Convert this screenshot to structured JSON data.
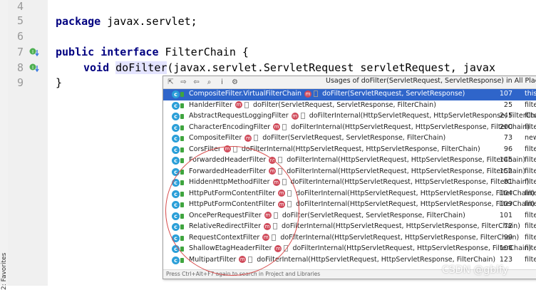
{
  "favorites_label": "2: Favorites",
  "gutter": {
    "lines": [
      "4",
      "5",
      "6",
      "7",
      "8",
      "9"
    ]
  },
  "code": {
    "line5_kw": "package",
    "line5_rest": " javax.servlet;",
    "line7_kw1": "public",
    "line7_kw2": "interface",
    "line7_rest": " FilterChain {",
    "line8_kw": "void",
    "line8_method": "doFilter",
    "line8_rest": "(javax.servlet.ServletRequest servletRequest, javax",
    "line9": "}"
  },
  "popup": {
    "title": "Usages of doFilter(ServletRequest, ServletResponse) in All Places",
    "toolbar": [
      "pin-icon",
      "forward-icon",
      "back-icon",
      "find-icon",
      "info-icon",
      "settings-icon"
    ],
    "rows": [
      {
        "cls": "CompositeFilter.VirtualFilterChain",
        "method": "doFilter(ServletRequest, ServletResponse)",
        "line": "107",
        "ctx": "this.",
        "selected": true
      },
      {
        "cls": "HanlderFilter",
        "method": "doFilter(ServletRequest, ServletResponse, FilterChain)",
        "line": "25",
        "ctx": "filte"
      },
      {
        "cls": "AbstractRequestLoggingFilter",
        "method": "doFilterInternal(HttpServletRequest, HttpServletResponse, FilterChain)",
        "line": "245",
        "ctx": "filte"
      },
      {
        "cls": "CharacterEncodingFilter",
        "method": "doFilterInternal(HttpServletRequest, HttpServletResponse, FilterChain)",
        "line": "200",
        "ctx": "filte"
      },
      {
        "cls": "CompositeFilter",
        "method": "doFilter(ServletRequest, ServletResponse, FilterChain)",
        "line": "73",
        "ctx": "new"
      },
      {
        "cls": "CorsFilter",
        "method": "doFilterInternal(HttpServletRequest, HttpServletResponse, FilterChain)",
        "line": "96",
        "ctx": "filte"
      },
      {
        "cls": "ForwardedHeaderFilter",
        "method": "doFilterInternal(HttpServletRequest, HttpServletResponse, FilterChain)",
        "line": "145",
        "ctx": "filte"
      },
      {
        "cls": "ForwardedHeaderFilter",
        "method": "doFilterInternal(HttpServletRequest, HttpServletResponse, FilterChain)",
        "line": "152",
        "ctx": "filte"
      },
      {
        "cls": "HiddenHttpMethodFilter",
        "method": "doFilterInternal(HttpServletRequest, HttpServletResponse, FilterChain)",
        "line": "81",
        "ctx": "filte"
      },
      {
        "cls": "HttpPutFormContentFilter",
        "method": "doFilterInternal(HttpServletRequest, HttpServletResponse, FilterChain)",
        "line": "104",
        "ctx": "filte"
      },
      {
        "cls": "HttpPutFormContentFilter",
        "method": "doFilterInternal(HttpServletRequest, HttpServletResponse, FilterChain)",
        "line": "109",
        "ctx": "filte"
      },
      {
        "cls": "OncePerRequestFilter",
        "method": "doFilter(ServletRequest, ServletResponse, FilterChain)",
        "line": "101",
        "ctx": "filte"
      },
      {
        "cls": "RelativeRedirectFilter",
        "method": "doFilterInternal(HttpServletRequest, HttpServletResponse, FilterChain)",
        "line": "72",
        "ctx": "filte"
      },
      {
        "cls": "RequestContextFilter",
        "method": "doFilterInternal(HttpServletRequest, HttpServletResponse, FilterChain)",
        "line": "99",
        "ctx": "filte"
      },
      {
        "cls": "ShallowEtagHeaderFilter",
        "method": "doFilterInternal(HttpServletRequest, HttpServletResponse, FilterChain)",
        "line": "108",
        "ctx": "filte"
      },
      {
        "cls": "MultipartFilter",
        "method": "doFilterInternal(HttpServletRequest, HttpServletResponse, FilterChain)",
        "line": "123",
        "ctx": "filte"
      }
    ],
    "footer": "Press Ctrl+Alt+F7 again to search in Project and Libraries"
  },
  "watermark": "CSDN @gblfy",
  "colors": {
    "selection": "#2f65ca",
    "annotation_circle": "#d95050"
  }
}
